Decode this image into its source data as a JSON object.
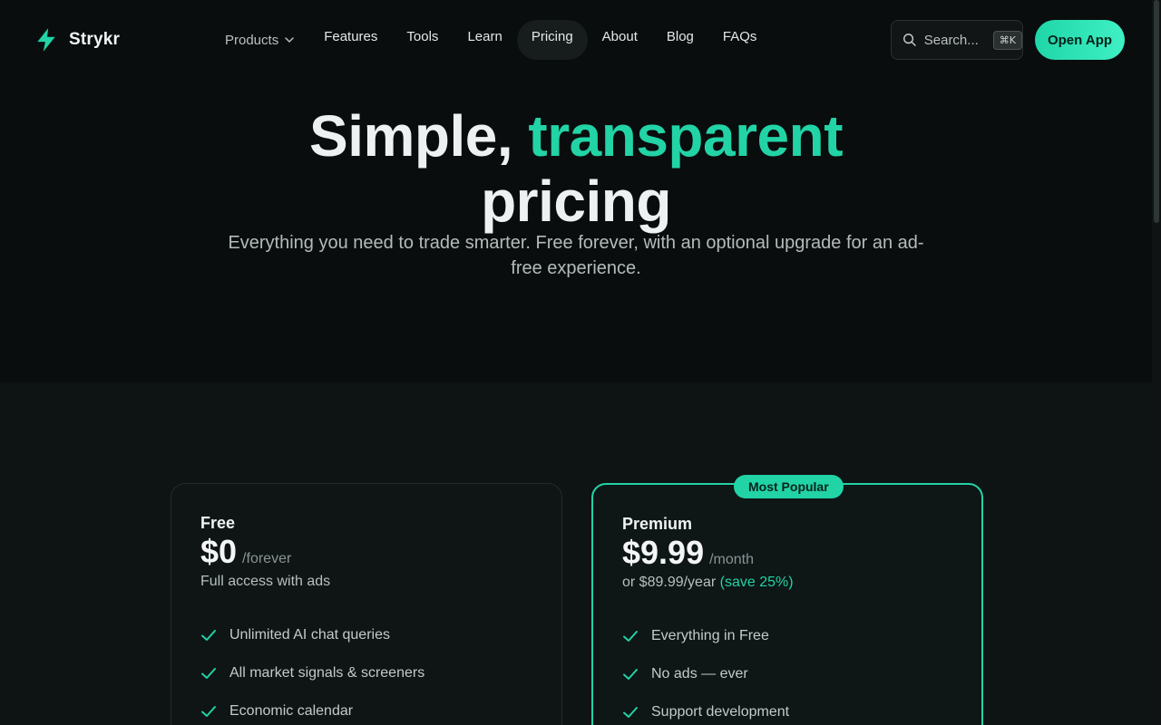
{
  "brand": {
    "name": "Strykr",
    "icon": "lightning-bolt-icon",
    "accent": "#22d3a6"
  },
  "nav": {
    "items": [
      {
        "label": "Products",
        "has_dropdown": true
      },
      {
        "label": "Features"
      },
      {
        "label": "Tools"
      },
      {
        "label": "Learn"
      },
      {
        "label": "Pricing",
        "active": true
      },
      {
        "label": "About"
      },
      {
        "label": "Blog"
      },
      {
        "label": "FAQs"
      }
    ],
    "search": {
      "placeholder": "Search...",
      "shortcut": "⌘K"
    },
    "cta": "Open App"
  },
  "hero": {
    "title_lead": "Simple, ",
    "title_accent": "transparent",
    "title_tail": "pricing",
    "subtitle": "Everything you need to trade smarter. Free forever, with an optional upgrade for an ad-free experience."
  },
  "plans": [
    {
      "name": "Free",
      "price": "$0",
      "period": "/forever",
      "description": "Full access with ads",
      "features": [
        "Unlimited AI chat queries",
        "All market signals & screeners",
        "Economic calendar"
      ]
    },
    {
      "name": "Premium",
      "badge": "Most Popular",
      "price": "$9.99",
      "period": "/month",
      "description": "or $89.99/year ",
      "savings": "(save 25%)",
      "features": [
        "Everything in Free",
        "No ads — ever",
        "Support development"
      ]
    }
  ]
}
